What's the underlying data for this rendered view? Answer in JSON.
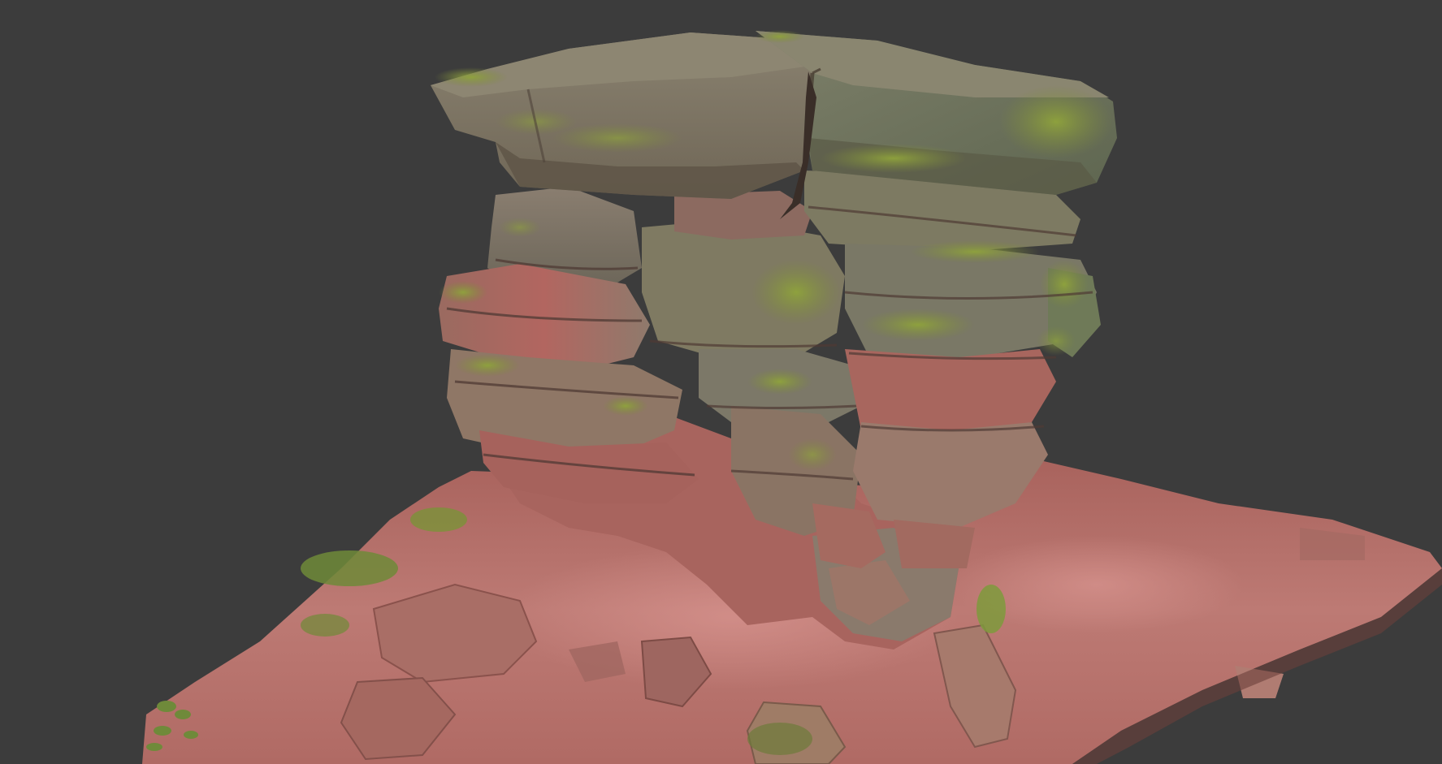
{
  "viewport": {
    "background_color": "#3c3c3c",
    "subject": "sandstone-rock-formation-3d-scan"
  },
  "palette": {
    "sand_ground": "#b8706a",
    "sand_ground_light": "#c98580",
    "rock_red": "#a85a55",
    "rock_grey": "#7d7468",
    "rock_dark": "#5a4a40",
    "moss_green": "#7d8a3a",
    "moss_bright": "#8fa33c",
    "shadow": "#4a3530"
  }
}
